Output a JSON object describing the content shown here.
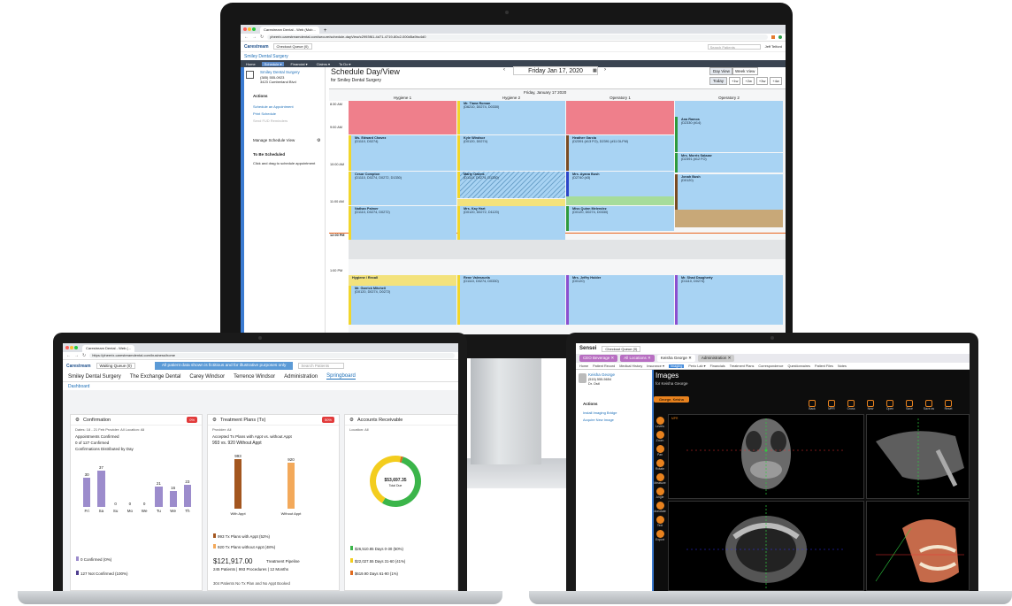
{
  "monitor": {
    "browser": {
      "tab_title": "Carestream Dental - Web (Mob...",
      "url": "pheerix.carestreamdental.com/secure/schedule-dayView/c2993f61-4d71-4719-80c2-000d5a9bc4d0"
    },
    "app": {
      "brand": "Carestream",
      "queue": "Checkout Queue (0)",
      "practice": "Smiley Dental Surgery",
      "search_placeholder": "Search Patients",
      "user": "Jeff Telford",
      "nav": [
        "Home",
        "Schedule ▾",
        "Financial ▾",
        "Claims ▾",
        "To Do ▾"
      ]
    },
    "sidebar": {
      "practice_name": "Smiley Dental Surgery",
      "phone": "(385) 555-0923",
      "address": "3423 Cumberland Blvd",
      "actions_title": "Actions",
      "actions": [
        "Schedule an Appointment",
        "Print Schedule",
        "Send FUD Reminders"
      ],
      "manage_title": "Manage Schedule View",
      "tbs_title": "To Be Scheduled",
      "tbs_hint": "Click and drag to schedule appointment"
    },
    "schedule": {
      "title": "Schedule Day/View",
      "subtitle": "for Smiley Dental Surgery",
      "date": "Friday Jan 17, 2020",
      "day_header": "Friday, January 17 2020",
      "view_buttons": [
        "Day View",
        "Week View"
      ],
      "today": "Today",
      "week_buttons": [
        "+1w",
        "+2w",
        "+3w",
        "+4w"
      ],
      "columns": [
        "Hygiene 1",
        "Hygiene 2",
        "Operatory 1",
        "Operatory 2"
      ],
      "times": [
        "8:30 AM",
        "9:00 AM",
        "10:00 AM",
        "11:00 AM",
        "12:00 PM",
        "1:00 PM"
      ],
      "appointments": [
        {
          "name": "Mr. Tiana Roman",
          "codes": "(D6210, D0274, D0330)",
          "col": 1
        },
        {
          "name": "Ana Ramos",
          "codes": "(D2330 (#14)",
          "col": 3
        },
        {
          "name": "Ms. Edward Chavez",
          "codes": "(D1110, D0274)",
          "col": 0
        },
        {
          "name": "Kyle Windsor",
          "codes": "(D0120, D0274)",
          "col": 1
        },
        {
          "name": "Heather Garcia",
          "codes": "(D2391 (#13 FO), D2391 (#11 DLFM)",
          "col": 2
        },
        {
          "name": "Mrs. Morris Salazar",
          "codes": "(D2391 (#12 FO)",
          "col": 3
        },
        {
          "name": "Cesar Compton",
          "codes": "(D1110, D0274, D0272, D1330)",
          "col": 0
        },
        {
          "name": "Marty Owens",
          "codes": "(D1110, D0274, D1330)",
          "col": 1
        },
        {
          "name": "Mrs. Ayana Bush",
          "codes": "(D2740 (#3)",
          "col": 2
        },
        {
          "name": "Jonah Bush",
          "codes": "(D0120)",
          "col": 3
        },
        {
          "name": "Nathan Palmer",
          "codes": "(D1110, D0274, D0272)",
          "col": 0
        },
        {
          "name": "Mrs. Kay Hart",
          "codes": "(D0120, D0272, D1120)",
          "col": 1
        },
        {
          "name": "Miss Quinn Melendez",
          "codes": "(D0120, D0274, D0330)",
          "col": 2
        },
        {
          "name": "Hygiene / Recall",
          "codes": "",
          "col": 0
        },
        {
          "name": "Mr. Garrick Mitchell",
          "codes": "(D0120, D0274, D0272)",
          "col": 0
        },
        {
          "name": "Rene Valenzuela",
          "codes": "(D1110, D0274, D0330)",
          "col": 1
        },
        {
          "name": "Mrs. Jeffry Holder",
          "codes": "(D0120)",
          "col": 2
        },
        {
          "name": "Mr. Shad Daugherty",
          "codes": "(D1110, D0274)",
          "col": 3
        }
      ]
    }
  },
  "laptop_left": {
    "browser": {
      "tab_title": "Carestream Dental - Web (...",
      "url": "https://pheerix.carestreamdental.com/business/home"
    },
    "queue": "Waiting Queue (0)",
    "banner": "All patient data shown is fictitious and for illustrative purposes only",
    "search_placeholder": "Search Patients",
    "tabs": [
      "Smiley Dental Surgery",
      "The Exchange Dental",
      "Carey Windsor",
      "Terrence Windsor",
      "Administration",
      "Springboard"
    ],
    "section": "Dashboard",
    "confirmation": {
      "title": "Confirmation",
      "badge": "0%",
      "filters": "Dates: 18 - 21 Feb   Provider: All   Location: All",
      "sub": "Appointments Confirmed",
      "count": "0 of 127 Confirmed",
      "dist": "Confirmations Distributed by Day",
      "legend": [
        "0 Confirmed (0%)",
        "127 Not Confirmed (100%)"
      ]
    },
    "treatment": {
      "title": "Treatment Plans (Tx)",
      "badge": "50%",
      "filters": "Provider: All",
      "sub": "Accepted Tx Plans with Appt vs. without Appt",
      "count": "993 vs. 920 Without Appt",
      "legend": [
        "993 Tx Plans with Appt (52%)",
        "920 Tx Plans without Appt (48%)"
      ],
      "pipeline": "$121,917.00",
      "pipeline_label": "Treatment Pipeline",
      "pipeline_sub": "245 Patients | 993 Procedures | 12 Months",
      "footer": "304 Patients No Tx Plan and No Appt Booked"
    },
    "ar": {
      "title": "Accounts Receivable",
      "filters": "Location: All",
      "total": "$53,697.35",
      "total_label": "Total Due",
      "legend": [
        "$26,510.85 Days 0-30 (50%)",
        "$22,027.55 Days 31-60 (41%)",
        "$619.90 Days 61-90 (1%)"
      ]
    }
  },
  "chart_data": [
    {
      "type": "bar",
      "categories": [
        "Fri",
        "Sa",
        "Su",
        "Mo",
        "We",
        "Tu",
        "We",
        "Th"
      ],
      "values": [
        30,
        37,
        0,
        0,
        0,
        21,
        16,
        23
      ]
    },
    {
      "type": "bar",
      "categories": [
        "With Appt",
        "Without Appt"
      ],
      "values": [
        993,
        920
      ]
    },
    {
      "type": "pie",
      "categories": [
        "Days 0-30",
        "Days 31-60",
        "Days 61-90"
      ],
      "values": [
        26510.85,
        22027.55,
        619.9
      ]
    }
  ],
  "laptop_right": {
    "brand": "Sensei",
    "queue": "Checkout Queue (0)",
    "tabs": [
      "CEO Beverage ✕",
      "All Locations ✕",
      "Keisha George ✕",
      "Administration ✕"
    ],
    "menu": [
      "Home",
      "Patient Record",
      "Medical History",
      "Insurance ▾",
      "Imaging",
      "Perio Lab ▾",
      "Financials",
      "Treatment Plans",
      "Correspondence",
      "Questionnaires",
      "Patient Files",
      "Notes"
    ],
    "patient": {
      "name": "Keisha George",
      "phone": "(515) 555-5654",
      "age": "Dr. Ostl"
    },
    "title": "Images",
    "subtitle": "for Keisha George",
    "chip": "George, Keisha",
    "actions_title": "Actions",
    "actions": [
      "Install Imaging Bridge",
      "Acquire New Image"
    ],
    "toolbar": [
      "Back",
      "MPR",
      "Cross",
      "New",
      "Open",
      "Save",
      "Save as",
      "Reset"
    ],
    "tools": [
      "Levels",
      "Zoom",
      "Pan",
      "Rotate",
      "Measure",
      "Angle",
      "Annotate",
      "Text",
      "Export"
    ]
  }
}
